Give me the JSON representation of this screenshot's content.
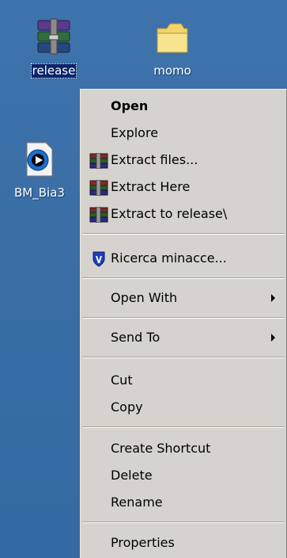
{
  "desktop": {
    "icons": [
      {
        "label": "release",
        "icon": "winrar-archive-icon",
        "selected": true
      },
      {
        "label": "momo",
        "icon": "folder-icon",
        "selected": false
      },
      {
        "label": "BM_Bia3",
        "icon": "media-file-icon",
        "selected": false
      }
    ]
  },
  "context_menu": {
    "items": {
      "open": "Open",
      "explore": "Explore",
      "extract_files": "Extract files...",
      "extract_here": "Extract Here",
      "extract_to": "Extract to release\\",
      "scan": "Ricerca minacce...",
      "open_with": "Open With",
      "send_to": "Send To",
      "cut": "Cut",
      "copy": "Copy",
      "create_shortcut": "Create Shortcut",
      "delete": "Delete",
      "rename": "Rename",
      "properties": "Properties"
    },
    "icons": {
      "winrar": "winrar-icon",
      "scan": "shield-icon",
      "submenu": "submenu-arrow-icon"
    }
  }
}
